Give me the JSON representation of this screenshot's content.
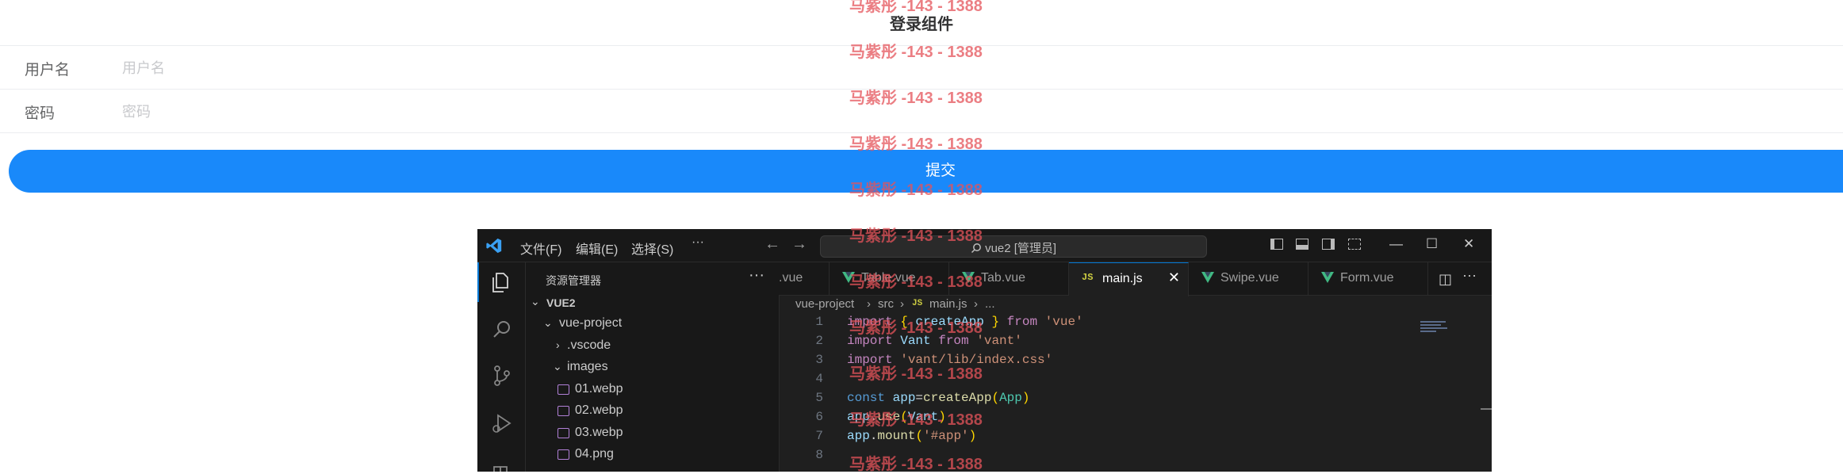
{
  "form": {
    "nav_title": "登录组件",
    "username_label": "用户名",
    "username_placeholder": "用户名",
    "password_label": "密码",
    "password_placeholder": "密码",
    "submit_label": "提交",
    "submit_color": "#1989fa"
  },
  "vscode": {
    "menu": {
      "file": "文件(F)",
      "edit": "编辑(E)",
      "selection": "选择(S)",
      "more": "···"
    },
    "nav": {
      "back": "←",
      "forward": "→"
    },
    "command_center": "vue2 [管理员]",
    "window": {
      "minimize": "—",
      "maximize": "☐",
      "close": "✕"
    },
    "sidebar": {
      "title": "资源管理器",
      "more": "···",
      "tree": [
        {
          "label": "VUE2",
          "twist": "⌄"
        },
        {
          "label": "vue-project",
          "twist": "⌄"
        },
        {
          "label": ".vscode",
          "twist": "›"
        },
        {
          "label": "images",
          "twist": "⌄"
        },
        {
          "label": "01.webp"
        },
        {
          "label": "02.webp"
        },
        {
          "label": "03.webp"
        },
        {
          "label": "04.png"
        }
      ]
    },
    "tabs": [
      {
        "label": ".vue"
      },
      {
        "label": "Table.vue"
      },
      {
        "label": "Tab.vue"
      },
      {
        "label": "main.js",
        "active": true,
        "close": "✕"
      },
      {
        "label": "Swipe.vue"
      },
      {
        "label": "Form.vue"
      }
    ],
    "tab_actions": {
      "split": "◫",
      "more": "···"
    },
    "breadcrumb": {
      "root": "vue-project",
      "sep": "›",
      "folder": "src",
      "js_badge": "JS",
      "file": "main.js",
      "ellipsis": "..."
    },
    "line_numbers": [
      "1",
      "2",
      "3",
      "4",
      "5",
      "6",
      "7",
      "8"
    ],
    "code": {
      "l1": {
        "import": "import",
        "open": "{",
        "name": " createApp ",
        "close": "}",
        "from": " from ",
        "mod": "'vue'"
      },
      "l2": {
        "import": "import",
        "name": " Vant",
        "from": " from ",
        "mod": "'vant'"
      },
      "l3": {
        "import": "import",
        "mod": " 'vant/lib/index.css'"
      },
      "l5": {
        "const": "const",
        "var": " app",
        "eq": "=",
        "fn": "createApp",
        "p1": "(",
        "arg": "App",
        "p2": ")"
      },
      "l6": {
        "obj": "app",
        "dot": ".",
        "fn": "use",
        "p1": "(",
        "arg": "Vant",
        "p2": ")"
      },
      "l7": {
        "obj": "app",
        "dot": ".",
        "fn": "mount",
        "p1": "(",
        "arg": "'#app'",
        "p2": ")"
      }
    },
    "accent_color": "#0078d4"
  },
  "watermark": {
    "text": "马紫彤 -143 - 1388",
    "color": "#e5535a"
  }
}
